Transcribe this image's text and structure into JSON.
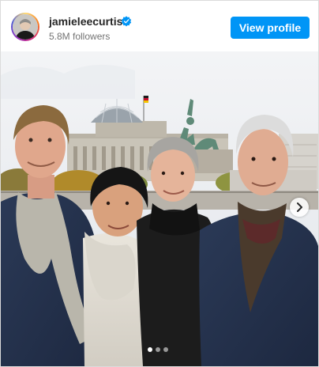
{
  "post": {
    "username": "jamieleecurtis",
    "verified": true,
    "followers": "5.8M followers",
    "view_profile_label": "View profile"
  },
  "carousel": {
    "slide_count": 3,
    "current_slide": 1
  },
  "colors": {
    "accent": "#0095f6",
    "verified_badge": "#0095f6",
    "username": "#262626",
    "secondary_text": "#737373"
  },
  "icons": {
    "verified": "verified-badge-icon",
    "next": "chevron-right-icon"
  }
}
